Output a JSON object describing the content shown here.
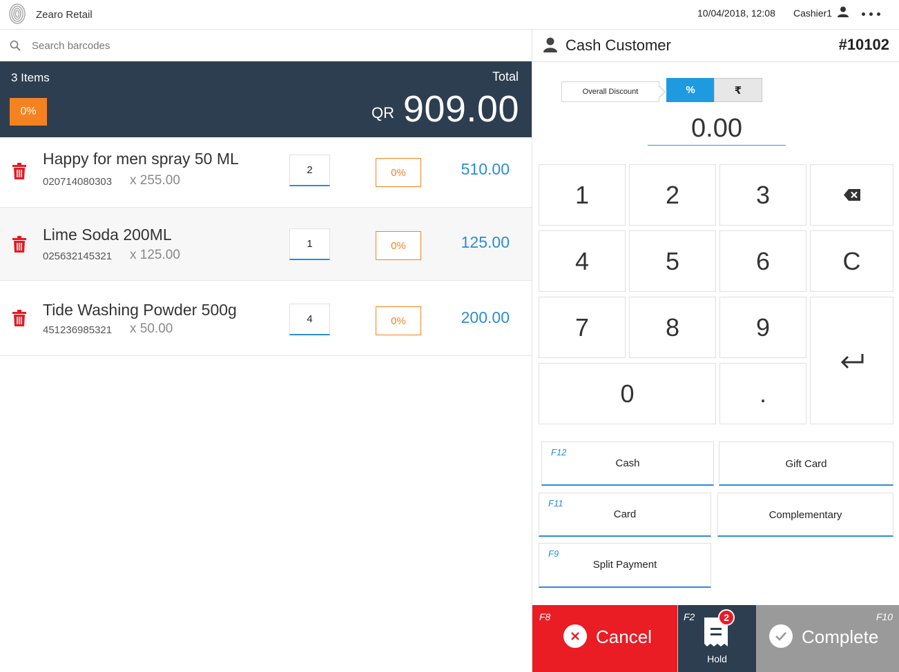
{
  "header": {
    "app_title": "Zearo Retail",
    "datetime": "10/04/2018, 12:08",
    "cashier": "Cashier1"
  },
  "search": {
    "placeholder": "Search barcodes"
  },
  "summary": {
    "items_count": "3 Items",
    "overall_discount_badge": "0%",
    "total_label": "Total",
    "currency": "QR",
    "total_amount": "909.00"
  },
  "cart": {
    "items": [
      {
        "name": "Happy for men spray 50 ML",
        "barcode": "020714080303",
        "unit_price": "x 255.00",
        "qty": "2",
        "discount": "0%",
        "line_total": "510.00"
      },
      {
        "name": "Lime Soda 200ML",
        "barcode": "025632145321",
        "unit_price": "x 125.00",
        "qty": "1",
        "discount": "0%",
        "line_total": "125.00"
      },
      {
        "name": "Tide Washing Powder 500g",
        "barcode": "451236985321",
        "unit_price": "x 50.00",
        "qty": "4",
        "discount": "0%",
        "line_total": "200.00"
      }
    ]
  },
  "customer": {
    "name": "Cash Customer",
    "order_number": "#10102"
  },
  "discount": {
    "label": "Overall Discount",
    "percent_toggle": "%",
    "currency_toggle": "₹",
    "value": "0.00"
  },
  "keypad": {
    "keys": [
      "1",
      "2",
      "3",
      "4",
      "5",
      "6",
      "7",
      "8",
      "9",
      "0",
      ".",
      "C"
    ]
  },
  "payments": {
    "cash": {
      "fkey": "F12",
      "label": "Cash"
    },
    "gift_card": {
      "label": "Gift Card"
    },
    "card": {
      "fkey": "F11",
      "label": "Card"
    },
    "complementary": {
      "label": "Complementary"
    },
    "split": {
      "fkey": "F9",
      "label": "Split Payment"
    }
  },
  "actions": {
    "cancel": {
      "fkey": "F8",
      "label": "Cancel"
    },
    "hold": {
      "fkey": "F2",
      "label": "Hold",
      "badge": "2"
    },
    "complete": {
      "fkey": "F10",
      "label": "Complete"
    }
  },
  "colors": {
    "summary_bg": "#2d3e50",
    "accent_blue": "#2a8dd4",
    "discount_orange": "#f58220",
    "cancel_red": "#ea1c24",
    "complete_gray": "#9a9a9a"
  }
}
